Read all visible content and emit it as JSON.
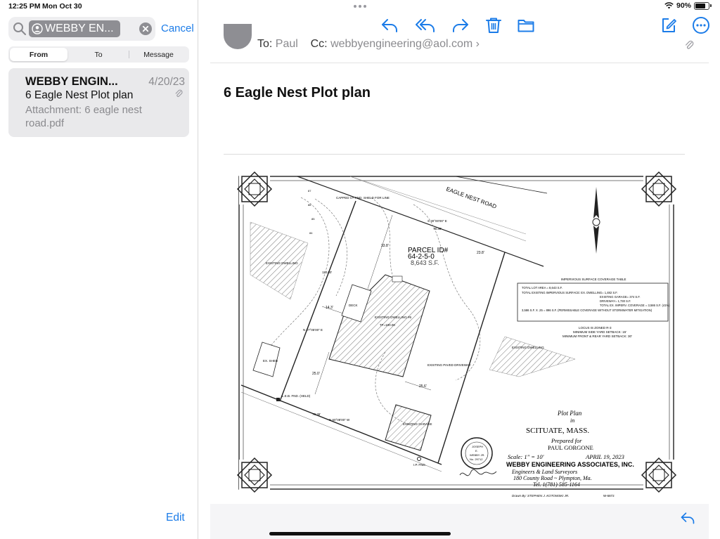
{
  "status": {
    "time": "12:25 PM",
    "date": "Mon Oct 30",
    "battery": "90%",
    "battery_level": 0.9,
    "icons": [
      "wifi-icon",
      "battery-icon"
    ]
  },
  "sidebar": {
    "search_token": "WEBBY EN...",
    "cancel_label": "Cancel",
    "scope": {
      "from": "From",
      "to": "To",
      "message": "Message",
      "selected": "From"
    },
    "message": {
      "sender": "WEBBY ENGIN...",
      "date": "4/20/23",
      "subject": "6 Eagle Nest Plot plan",
      "preview": "Attachment: 6 eagle nest road.pdf"
    },
    "edit_label": "Edit"
  },
  "toolbar": {
    "icons": [
      "reply-icon",
      "reply-all-icon",
      "forward-icon",
      "trash-icon",
      "folder-icon",
      "compose-icon",
      "more-icon"
    ]
  },
  "email": {
    "to_label": "To:",
    "to": "Paul",
    "cc_label": "Cc:",
    "cc": "webbyengineering@aol.com",
    "subject": "6 Eagle Nest Plot plan"
  },
  "plan": {
    "road": "EAGLE NEST ROAD",
    "parcel_label": "PARCEL ID#",
    "parcel_id": "64-2-5-0",
    "area": "8,643 S.F.",
    "dwelling_left": "EXISTING DWELLING",
    "dwelling_right": "EXISTING DWELLING",
    "dwelling_main": "EXISTING DWELLING #6",
    "tf": "TF=100.00",
    "deck": "DECK",
    "shed": "EX. SHED",
    "garage": "EXISTING GARAGE",
    "driveway": "EXISTING PAVED DRIVEWAY",
    "capped": "CAPPED I.P. FND. SHELD FOR LINE",
    "leb": "L.E.B. FND. (HELD)",
    "ip": "I.P. FND.",
    "bearing_top": "S 30°00'00\" E",
    "dist_top": "78.36'",
    "bearing_bottom": "N 60°08'00\" W",
    "dist_bottom": "78.36'",
    "bearing_left": "N 27°05'00\" E",
    "dist_left": "110.00'",
    "dim_1": "14.3'",
    "dim_2": "25.6'",
    "dim_3": "33.8'",
    "dim_4": "25.0'",
    "dim_5": "23.8'",
    "table": {
      "title": "IMPERVIOUS SURFACE COVERAGE TABLE",
      "line1": "TOTAL LOT AREA = 8,643 S.F.",
      "line2": "TOTAL EXISTING IMPERVIOUS SURFACE:   EX. DWELLING= 1,482 S.F.",
      "line3": "EXISTING GARAGE= 374 S.F.",
      "line4": "DRIVEWAY= 1,730 S.F.",
      "line5": "TOTAL EX. IMPERV. COVERAGE = 3,586 S.F. (41%)",
      "line6": "3,586 S.F. X .25 = 896 S.F. (PERMISSABLE COVERAGE WITHOUT STORMWATER MITIGATION)"
    },
    "zone1": "LOCUS IS ZONED R-3",
    "zone2": "MINIMUM SIDE YARD SETBACK: 15'",
    "zone3": "MINIMUM FRONT & REAR YARD SETBACK: 30'",
    "title1": "Plot Plan",
    "title2": "in",
    "title3": "SCITUATE,  MASS.",
    "title4": "Prepared for",
    "title5": "PAUL GORGONE",
    "scale": "Scale: 1\" = 10'",
    "date": "APRIL 19, 2023",
    "company": "WEBBY ENGINEERING ASSOCIATES, INC.",
    "sub1": "Engineers  &  Land Surveyors",
    "sub2": "180 County Road ~ Plympton, Ma.",
    "tel": "Tel. 1(781) 585-1164",
    "drawn": "Drawn By: STEPHEN J. KOTOWSKI JR.",
    "job": "W-6872",
    "seal1": "JOSEPH",
    "seal2": "E.",
    "seal3": "WEBBY JR.",
    "seal4": "No. 29712",
    "signature": "Joseph E Webby Jr",
    "contours": [
      "87",
      "86",
      "85",
      "84"
    ]
  }
}
